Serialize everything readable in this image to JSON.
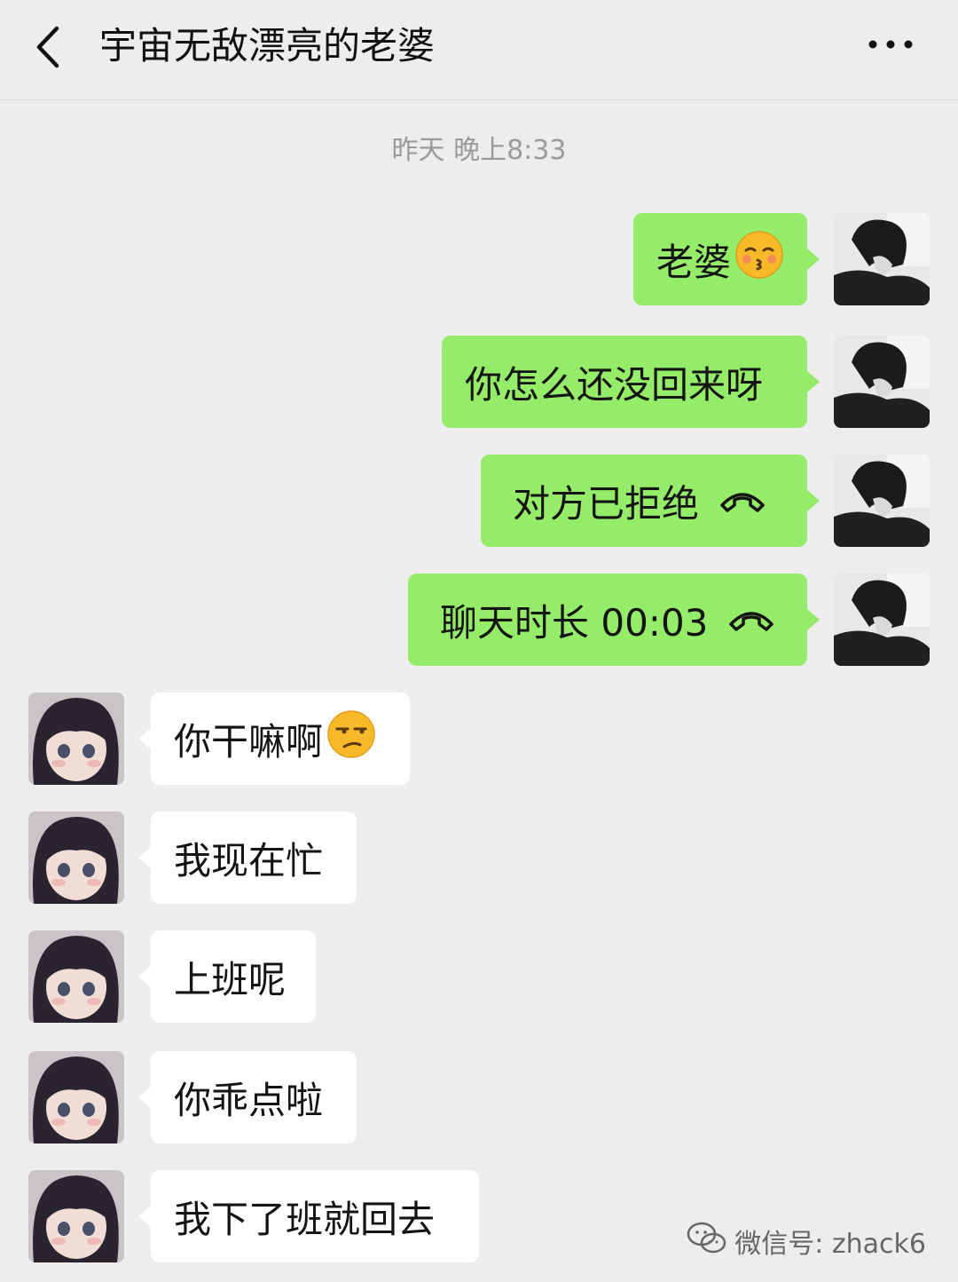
{
  "header": {
    "title": "宇宙无敌漂亮的老婆",
    "back_icon": "chevron-left-icon",
    "more_icon": "more-dots-icon"
  },
  "timestamp": "昨天 晚上8:33",
  "messages": [
    {
      "side": "out",
      "text": "老婆",
      "emoji": "kissing-face-icon"
    },
    {
      "side": "out",
      "text": "你怎么还没回来呀"
    },
    {
      "side": "out",
      "text": "对方已拒绝",
      "icon": "hang-up-icon"
    },
    {
      "side": "out",
      "text": "聊天时长 00:03",
      "icon": "hang-up-icon"
    },
    {
      "side": "in",
      "text": "你干嘛啊",
      "emoji": "unamused-face-icon"
    },
    {
      "side": "in",
      "text": "我现在忙"
    },
    {
      "side": "in",
      "text": "上班呢"
    },
    {
      "side": "in",
      "text": "你乖点啦"
    },
    {
      "side": "in",
      "text": "我下了班就回去"
    }
  ],
  "watermark": {
    "text": "微信号: zhack6",
    "icon": "wechat-logo-icon"
  },
  "colors": {
    "background": "#ededed",
    "outgoing_bubble": "#95ec69",
    "incoming_bubble": "#ffffff"
  }
}
